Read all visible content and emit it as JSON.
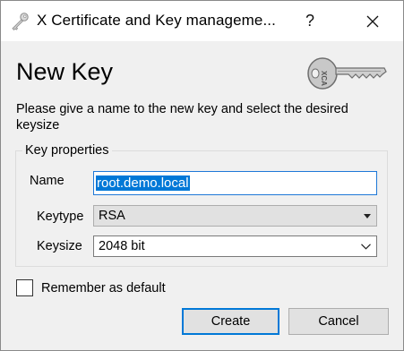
{
  "window": {
    "title": "X Certificate and Key manageme...",
    "help_label": "?",
    "app_icon": "key-icon",
    "close_icon": "close-icon"
  },
  "page": {
    "heading": "New Key",
    "key_image_label": "XCA",
    "instructions": "Please give a name to the new key and select the desired keysize"
  },
  "group": {
    "title": "Key properties",
    "name_label": "Name",
    "name_value": "root.demo.local",
    "keytype_label": "Keytype",
    "keytype_value": "RSA",
    "keysize_label": "Keysize",
    "keysize_value": "2048 bit"
  },
  "options": {
    "remember_label": "Remember as default",
    "remember_checked": false
  },
  "buttons": {
    "create": "Create",
    "cancel": "Cancel"
  },
  "colors": {
    "accent": "#0078d7",
    "background": "#f0f0f0"
  }
}
